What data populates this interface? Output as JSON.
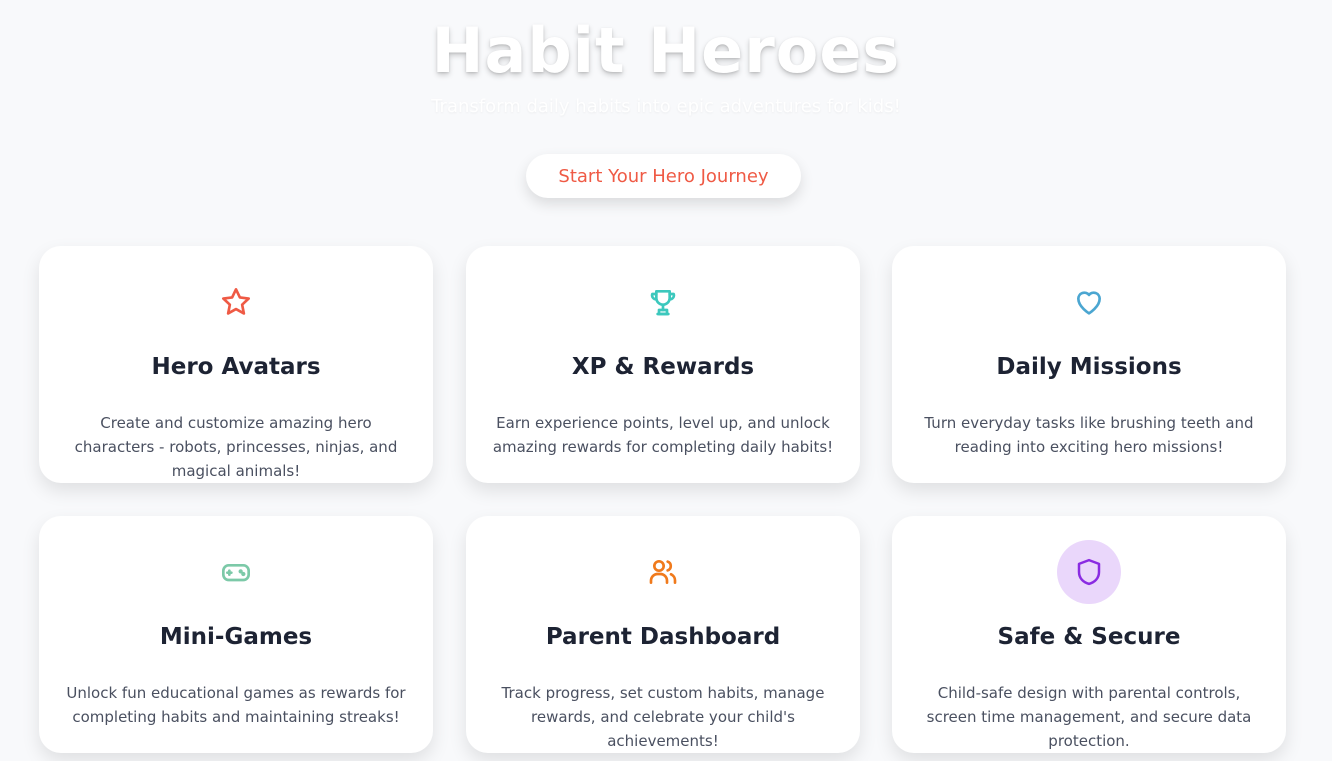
{
  "hero": {
    "title": "Habit Heroes",
    "subtitle": "Transform daily habits into epic adventures for kids!",
    "cta_label": "Start Your Hero Journey"
  },
  "colors": {
    "accent": "#ef5a45",
    "background": "#f8f9fb",
    "title_text": "#1d2333"
  },
  "features": [
    {
      "icon": "star-icon",
      "color": "#ef5a45",
      "title": "Hero Avatars",
      "description": "Create and customize amazing hero characters - robots, princesses, ninjas, and magical animals!"
    },
    {
      "icon": "trophy-icon",
      "color": "#3cc8bd",
      "title": "XP & Rewards",
      "description": "Earn experience points, level up, and unlock amazing rewards for completing daily habits!"
    },
    {
      "icon": "heart-icon",
      "color": "#4ba6d1",
      "title": "Daily Missions",
      "description": "Turn everyday tasks like brushing teeth and reading into exciting hero missions!"
    },
    {
      "icon": "gamepad-icon",
      "color": "#7cc9a8",
      "title": "Mini-Games",
      "description": "Unlock fun educational games as rewards for completing habits and maintaining streaks!"
    },
    {
      "icon": "users-icon",
      "color": "#f07a1c",
      "title": "Parent Dashboard",
      "description": "Track progress, set custom habits, manage rewards, and celebrate your child's achievements!"
    },
    {
      "icon": "shield-icon",
      "color": "#8a2be2",
      "title": "Safe & Secure",
      "description": "Child-safe design with parental controls, screen time management, and secure data protection."
    }
  ]
}
